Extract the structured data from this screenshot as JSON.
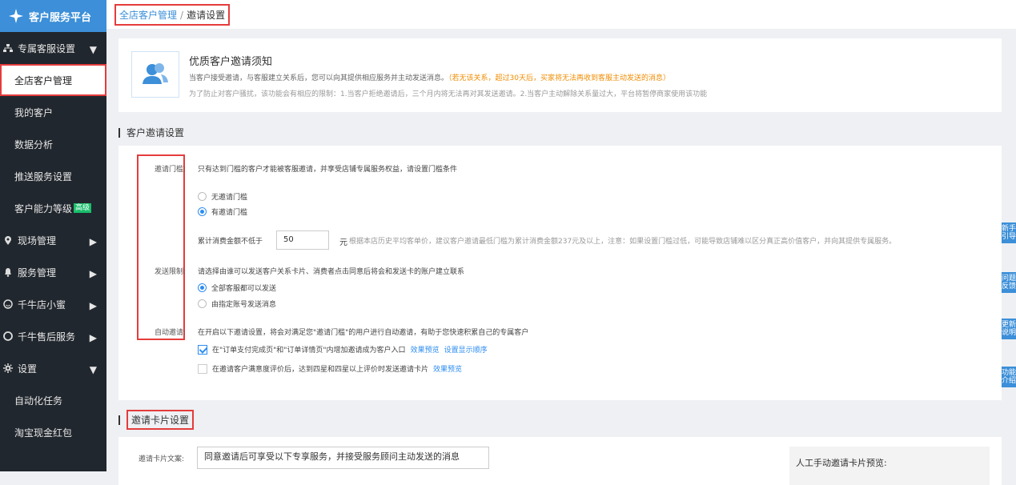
{
  "sidebar": {
    "logo_text": "客户服务平台",
    "groups": [
      {
        "label": "专属客服设置",
        "expanded": true
      },
      {
        "label": "现场管理",
        "expanded": false
      },
      {
        "label": "服务管理",
        "expanded": false
      },
      {
        "label": "千牛店小蜜",
        "expanded": false
      },
      {
        "label": "千牛售后服务",
        "expanded": false
      },
      {
        "label": "设置",
        "expanded": true
      }
    ],
    "items": [
      {
        "label": "全店客户管理",
        "active": true
      },
      {
        "label": "我的客户"
      },
      {
        "label": "数据分析"
      },
      {
        "label": "推送服务设置"
      },
      {
        "label": "客户能力等级",
        "badge": "高级"
      },
      {
        "label": "自动化任务"
      },
      {
        "label": "淘宝现金红包"
      }
    ]
  },
  "breadcrumb": {
    "parent": "全店客户管理",
    "separator": "/",
    "current": "邀请设置"
  },
  "notice": {
    "title": "优质客户邀请须知",
    "line1": "当客户接受邀请，与客服建立关系后，您可以向其提供相应服务并主动发送消息。",
    "line1_warning": "（若无该关系，超过30天后，买家将无法再收到客服主动发送的消息）",
    "line2": "为了防止对客户骚扰，该功能会有相应的限制：1.当客户拒绝邀请后，三个月内将无法再对其发送邀请。2.当客户主动解除关系量过大，平台将暂停商家使用该功能"
  },
  "invite_settings": {
    "section_title": "客户邀请设置",
    "threshold": {
      "label": "邀请门槛:",
      "description": "只有达到门槛的客户才能被客服邀请，并享受店铺专属服务权益，请设置门槛条件",
      "options": [
        "无邀请门槛",
        "有邀请门槛"
      ],
      "selected": 1,
      "amount_label": "累计消费金额不低于",
      "amount_value": "50",
      "amount_unit": "元",
      "amount_hint": "根据本店历史平均客单价，建议客户邀请最低门槛为累计消费金额237元及以上，注意：如果设置门槛过低，可能导致店铺难以区分真正高价值客户，并向其提供专属服务。"
    },
    "send_limit": {
      "label": "发送限制:",
      "description": "请选择由谁可以发送客户关系卡片、消费者点击同意后将会和发送卡的账户建立联系",
      "options": [
        "全部客服都可以发送",
        "由指定账号发送消息"
      ],
      "selected": 0
    },
    "auto_invite": {
      "label": "自动邀请:",
      "description": "在开启以下邀请设置，将会对满足您\"邀请门槛\"的用户进行自动邀请，有助于您快速积累自己的专属客户",
      "checks": [
        {
          "text": "在\"订单支付完成页\"和\"订单详情页\"内增加邀请成为客户入口",
          "checked": true,
          "links": [
            "效果预览",
            "设置显示顺序"
          ]
        },
        {
          "text": "在邀请客户满意度评价后，达到四星和四星以上评价时发送邀请卡片",
          "checked": false,
          "links": [
            "效果预览"
          ]
        }
      ]
    }
  },
  "card_settings": {
    "section_title": "邀请卡片设置",
    "copy_label": "邀请卡片文案:",
    "copy_value": "同意邀请后可享受以下专享服务，并接受服务顾问主动发送的消息",
    "preview_label": "人工手动邀请卡片预览:"
  },
  "float_tabs": [
    "新手引导",
    "问题反馈",
    "更新说明",
    "功能介绍"
  ]
}
